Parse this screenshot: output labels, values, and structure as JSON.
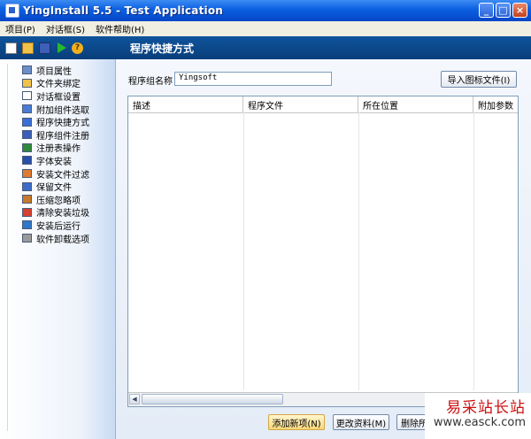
{
  "window": {
    "title": "YingInstall 5.5 - Test Application",
    "minimize": "_",
    "maximize": "□",
    "close": "×"
  },
  "menu": [
    "项目(P)",
    "对话框(S)",
    "软件帮助(H)"
  ],
  "toolbar": {
    "icons": [
      "new-icon",
      "open-icon",
      "save-icon",
      "run-icon",
      "help-icon"
    ],
    "help_glyph": "?"
  },
  "section_title": "程序快捷方式",
  "sidebar": {
    "items": [
      {
        "label": "项目属性",
        "icon": "properties-icon",
        "color": "#6a8fc8"
      },
      {
        "label": "文件夹绑定",
        "icon": "folder-icon",
        "color": "#f0c24a"
      },
      {
        "label": "对话框设置",
        "icon": "dialog-icon",
        "color": "#ffffff"
      },
      {
        "label": "附加组件选取",
        "icon": "component-icon",
        "color": "#4a7cd6"
      },
      {
        "label": "程序快捷方式",
        "icon": "shortcut-icon",
        "color": "#3a6fd8"
      },
      {
        "label": "程序组件注册",
        "icon": "register-icon",
        "color": "#3b5fb8"
      },
      {
        "label": "注册表操作",
        "icon": "registry-icon",
        "color": "#2e8a3a"
      },
      {
        "label": "字体安装",
        "icon": "font-icon",
        "color": "#2a4fa8"
      },
      {
        "label": "安装文件过滤",
        "icon": "filter-icon",
        "color": "#e07a30"
      },
      {
        "label": "保留文件",
        "icon": "keep-file-icon",
        "color": "#3c6cc8"
      },
      {
        "label": "压缩忽略项",
        "icon": "compress-icon",
        "color": "#c87a2a"
      },
      {
        "label": "清除安装垃圾",
        "icon": "clean-icon",
        "color": "#d84030"
      },
      {
        "label": "安装后运行",
        "icon": "post-run-icon",
        "color": "#2f78c8"
      },
      {
        "label": "软件卸载选项",
        "icon": "uninstall-icon",
        "color": "#9a9a9a"
      }
    ]
  },
  "form": {
    "group_label": "程序组名称",
    "group_value": "Yingsoft",
    "import_button": "导入图标文件(I)"
  },
  "table": {
    "columns": [
      "描述",
      "程序文件",
      "所在位置",
      "附加参数"
    ]
  },
  "buttons": {
    "add": "添加新项(N)",
    "edit": "更改资料(M)",
    "delete": "删除所"
  },
  "watermark": {
    "cn": "易采站长站",
    "url": "www.easck.com"
  }
}
